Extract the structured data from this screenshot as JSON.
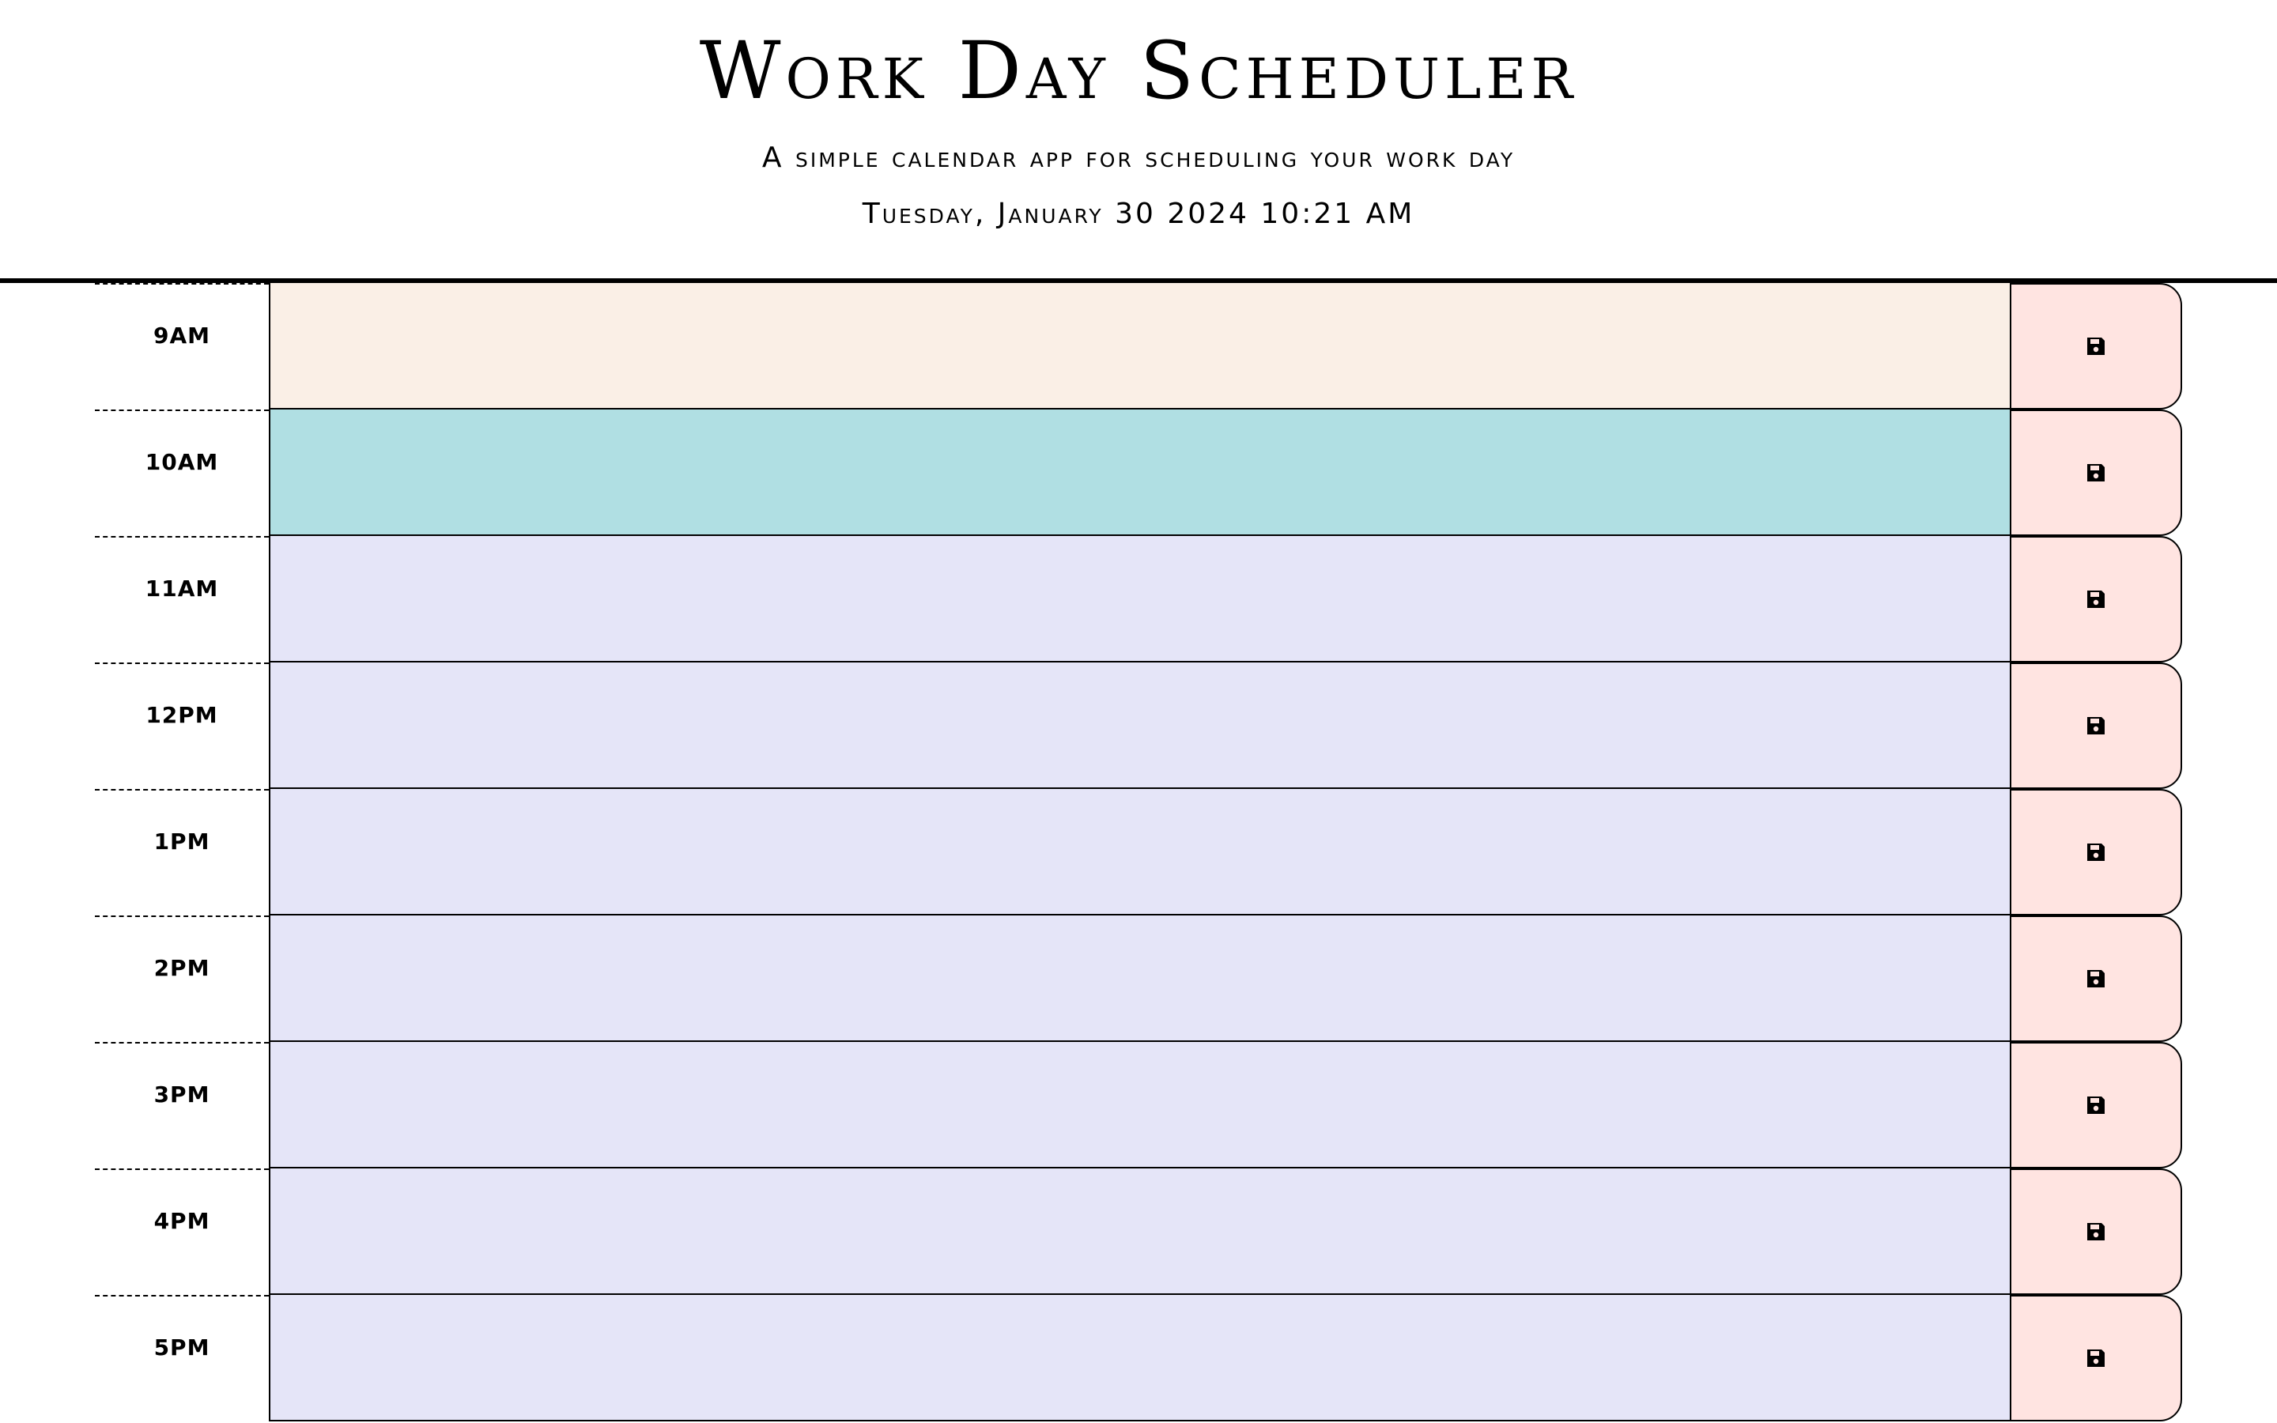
{
  "header": {
    "title": "Work Day Scheduler",
    "subtitle": "A simple calendar app for scheduling your work day",
    "current_day": "Tuesday, January 30 2024 10:21 AM"
  },
  "colors": {
    "past": "#faefe6",
    "present": "#b0dfe3",
    "future": "#e5e5f8",
    "save_button": "#ffe4e1"
  },
  "schedule": [
    {
      "hour": "9AM",
      "status": "past",
      "value": "",
      "icon": "floppy-disk-icon"
    },
    {
      "hour": "10AM",
      "status": "present",
      "value": "",
      "icon": "floppy-disk-icon"
    },
    {
      "hour": "11AM",
      "status": "future",
      "value": "",
      "icon": "floppy-disk-icon"
    },
    {
      "hour": "12PM",
      "status": "future",
      "value": "",
      "icon": "floppy-disk-icon"
    },
    {
      "hour": "1PM",
      "status": "future",
      "value": "",
      "icon": "floppy-disk-icon"
    },
    {
      "hour": "2PM",
      "status": "future",
      "value": "",
      "icon": "floppy-disk-icon"
    },
    {
      "hour": "3PM",
      "status": "future",
      "value": "",
      "icon": "floppy-disk-icon"
    },
    {
      "hour": "4PM",
      "status": "future",
      "value": "",
      "icon": "floppy-disk-icon"
    },
    {
      "hour": "5PM",
      "status": "future",
      "value": "",
      "icon": "floppy-disk-icon"
    }
  ]
}
